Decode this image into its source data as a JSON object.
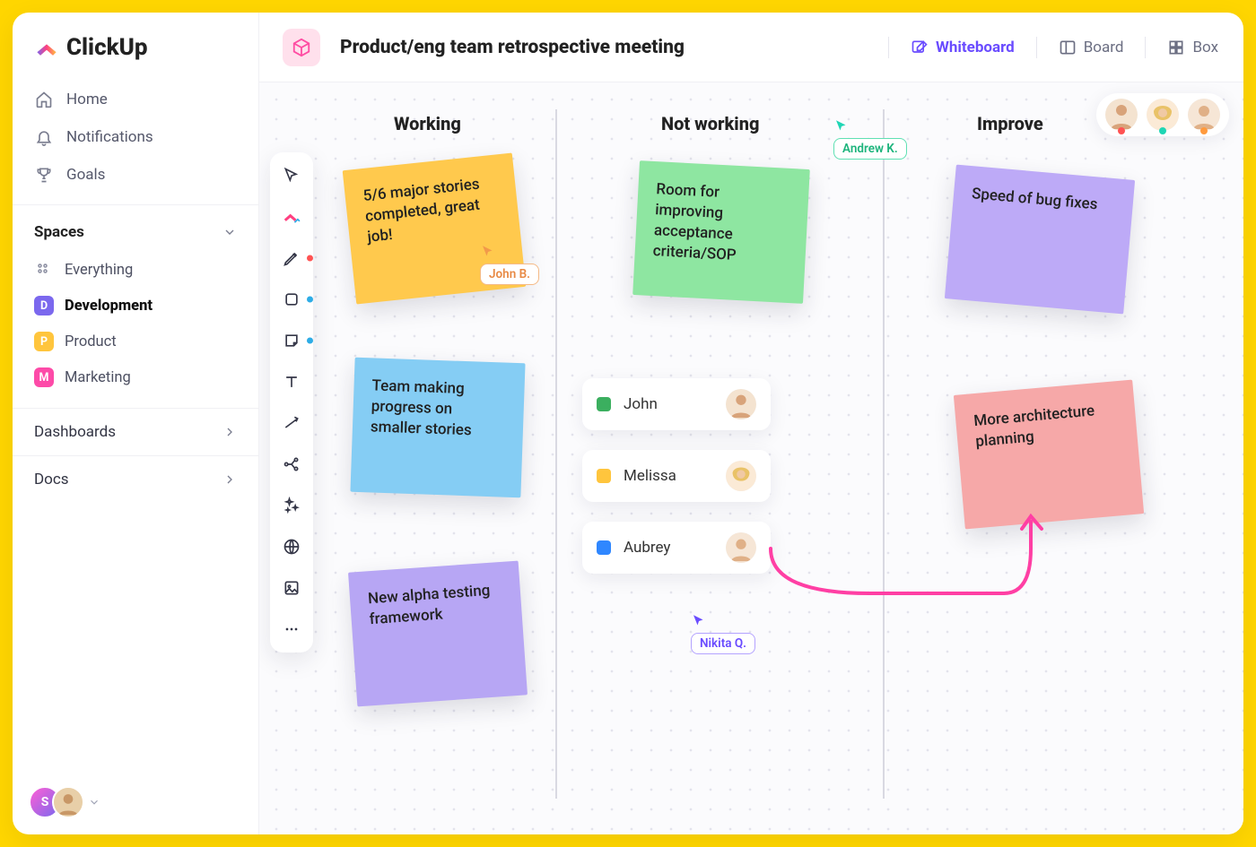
{
  "app": {
    "name": "ClickUp"
  },
  "nav": {
    "home": "Home",
    "notifications": "Notifications",
    "goals": "Goals"
  },
  "spaces": {
    "label": "Spaces",
    "items": [
      {
        "label": "Everything"
      },
      {
        "label": "Development",
        "letter": "D"
      },
      {
        "label": "Product",
        "letter": "P"
      },
      {
        "label": "Marketing",
        "letter": "M"
      }
    ]
  },
  "sections": {
    "dashboards": "Dashboards",
    "docs": "Docs"
  },
  "profile": {
    "initial": "S"
  },
  "header": {
    "title": "Product/eng team retrospective meeting",
    "views": {
      "whiteboard": "Whiteboard",
      "board": "Board",
      "box": "Box"
    }
  },
  "columns": {
    "working": "Working",
    "not_working": "Not working",
    "improve": "Improve"
  },
  "notes": {
    "n1": "5/6 major stories completed, great job!",
    "n2": "Team making progress on smaller stories",
    "n3": "New alpha testing framework",
    "n4": "Room for improving acceptance criteria/SOP",
    "n5": "Speed of bug fixes",
    "n6": "More architecture planning"
  },
  "people": [
    {
      "name": "John",
      "color": "#3BAF5F"
    },
    {
      "name": "Melissa",
      "color": "#FFC53D"
    },
    {
      "name": "Aubrey",
      "color": "#2F87FF"
    }
  ],
  "cursors": {
    "john": "John B.",
    "andrew": "Andrew K.",
    "nikita": "Nikita Q."
  },
  "collab_dots": [
    "#FF5252",
    "#1FD6B5",
    "#FF9A3D"
  ]
}
